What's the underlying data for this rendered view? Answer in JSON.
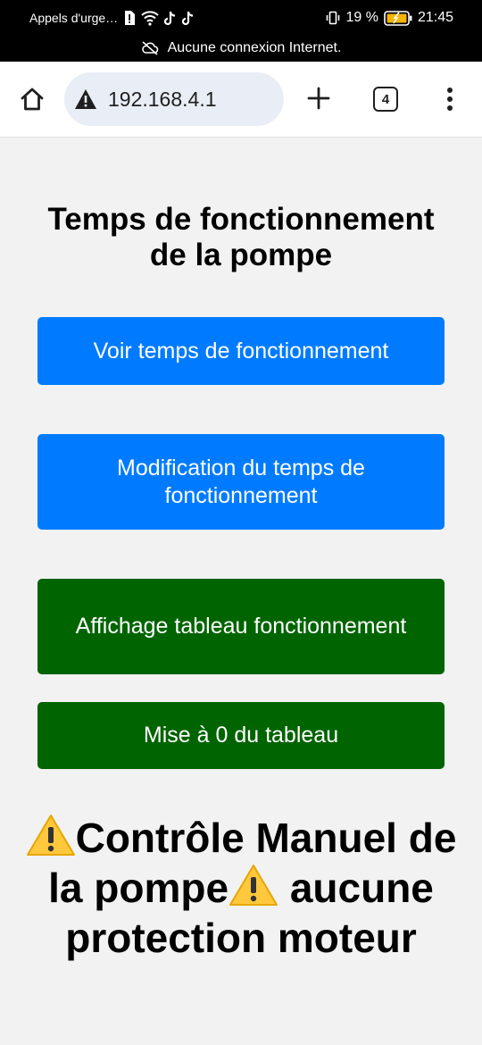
{
  "status_bar": {
    "carrier_text": "Appels d'urge…",
    "battery_percent": "19 %",
    "time": "21:45",
    "connection_message": "Aucune connexion Internet.",
    "icons": [
      "sim-alert-icon",
      "wifi-icon",
      "tiktok-icon",
      "tiktok-icon",
      "vibrate-icon",
      "battery-icon",
      "cloud-off-icon"
    ]
  },
  "browser": {
    "url": "192.168.4.1",
    "tab_count": "4",
    "icons": [
      "home-icon",
      "warning-icon",
      "plus-icon",
      "tabs-icon",
      "more-vert-icon"
    ]
  },
  "page": {
    "title": "Temps de fonctionnement de la pompe",
    "buttons": [
      {
        "label": "Voir temps de fonctionnement",
        "color": "#007bff"
      },
      {
        "label": "Modification du temps de fonctionnement",
        "color": "#007bff"
      },
      {
        "label": "Affichage tableau fonctionnement",
        "color": "#006400"
      },
      {
        "label": "Mise à 0 du tableau",
        "color": "#006400"
      }
    ],
    "manual_section": {
      "part1": "Contrôle Manuel de la pompe",
      "part2": "aucune protection moteur",
      "icon": "warning-emoji-icon"
    }
  }
}
